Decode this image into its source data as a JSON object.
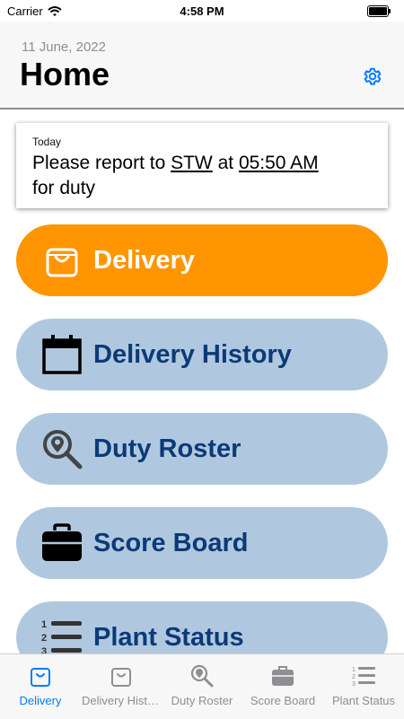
{
  "status_bar": {
    "carrier": "Carrier",
    "time": "4:58 PM"
  },
  "header": {
    "date": "11 June, 2022",
    "title": "Home"
  },
  "notice": {
    "label": "Today",
    "prefix": "Please report to ",
    "location": "STW",
    "middle": " at ",
    "time": "05:50 AM",
    "suffix": "for duty"
  },
  "menu": [
    {
      "label": "Delivery",
      "icon": "shopping-bag-icon"
    },
    {
      "label": "Delivery History",
      "icon": "calendar-icon"
    },
    {
      "label": "Duty Roster",
      "icon": "location-search-icon"
    },
    {
      "label": "Score Board",
      "icon": "briefcase-icon"
    },
    {
      "label": "Plant Status",
      "icon": "numbered-list-icon"
    }
  ],
  "tabs": [
    {
      "label": "Delivery",
      "icon": "shopping-bag-icon",
      "active": true
    },
    {
      "label": "Delivery History",
      "icon": "shopping-bag-icon"
    },
    {
      "label": "Duty Roster",
      "icon": "location-search-icon"
    },
    {
      "label": "Score Board",
      "icon": "briefcase-icon"
    },
    {
      "label": "Plant Status",
      "icon": "numbered-list-icon"
    }
  ],
  "colors": {
    "accent": "#ff9500",
    "button_bg": "#b0c8df",
    "button_text": "#0b3a77",
    "tint": "#007aff"
  }
}
